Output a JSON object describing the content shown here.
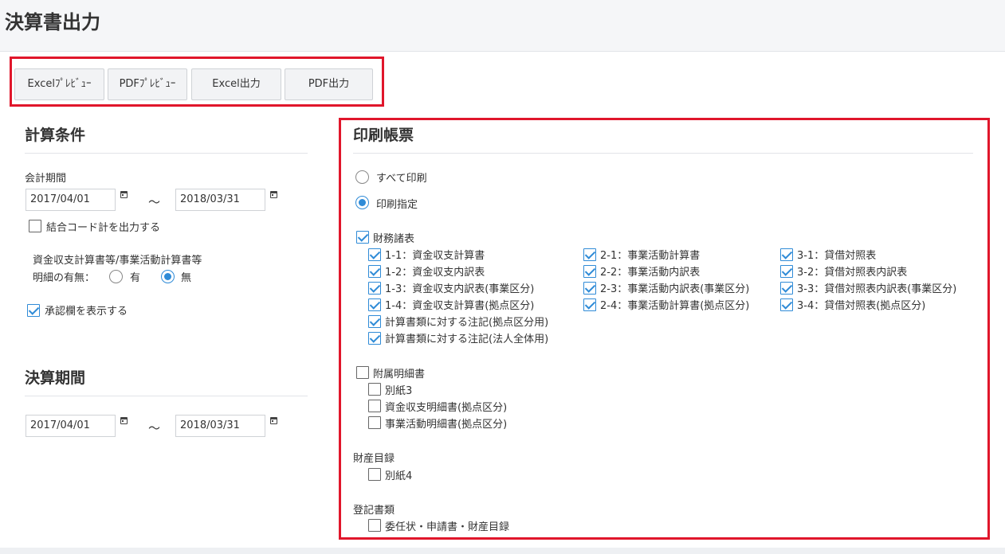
{
  "page_title": "決算書出力",
  "toolbar": {
    "excel_preview": "Excelﾌﾟﾚﾋﾞｭｰ",
    "pdf_preview": "PDFﾌﾟﾚﾋﾞｭｰ",
    "excel_output": "Excel出力",
    "pdf_output": "PDF出力"
  },
  "calc_conditions": {
    "title": "計算条件",
    "period_label": "会計期間",
    "period_from": "2017/04/01",
    "period_to": "2018/03/31",
    "tilde": "〜",
    "combine_code_label": "結合コード計を出力する",
    "detail_line1": "資金収支計算書等/事業活動計算書等",
    "detail_line2": "明細の有無：",
    "detail_yes": "有",
    "detail_no": "無",
    "approval_label": "承認欄を表示する"
  },
  "closing_period": {
    "title": "決算期間",
    "from": "2017/04/01",
    "to": "2018/03/31",
    "tilde": "〜"
  },
  "print_forms": {
    "title": "印刷帳票",
    "print_all": "すべて印刷",
    "print_specified": "印刷指定",
    "financial": {
      "label": "財務諸表",
      "col1": [
        "1-1：資金収支計算書",
        "1-2：資金収支内訳表",
        "1-3：資金収支内訳表(事業区分)",
        "1-4：資金収支計算書(拠点区分)",
        "計算書類に対する注記(拠点区分用)",
        "計算書類に対する注記(法人全体用)"
      ],
      "col2": [
        "2-1：事業活動計算書",
        "2-2：事業活動内訳表",
        "2-3：事業活動内訳表(事業区分)",
        "2-4：事業活動計算書(拠点区分)"
      ],
      "col3": [
        "3-1：貸借対照表",
        "3-2：貸借対照表内訳表",
        "3-3：貸借対照表内訳表(事業区分)",
        "3-4：貸借対照表(拠点区分)"
      ]
    },
    "supplementary": {
      "label": "附属明細書",
      "items": [
        "別紙3",
        "資金収支明細書(拠点区分)",
        "事業活動明細書(拠点区分)"
      ]
    },
    "property": {
      "label": "財産目録",
      "items": [
        "別紙4"
      ]
    },
    "registration": {
      "label": "登記書類",
      "items": [
        "委任状・申請書・財産目録"
      ]
    }
  }
}
